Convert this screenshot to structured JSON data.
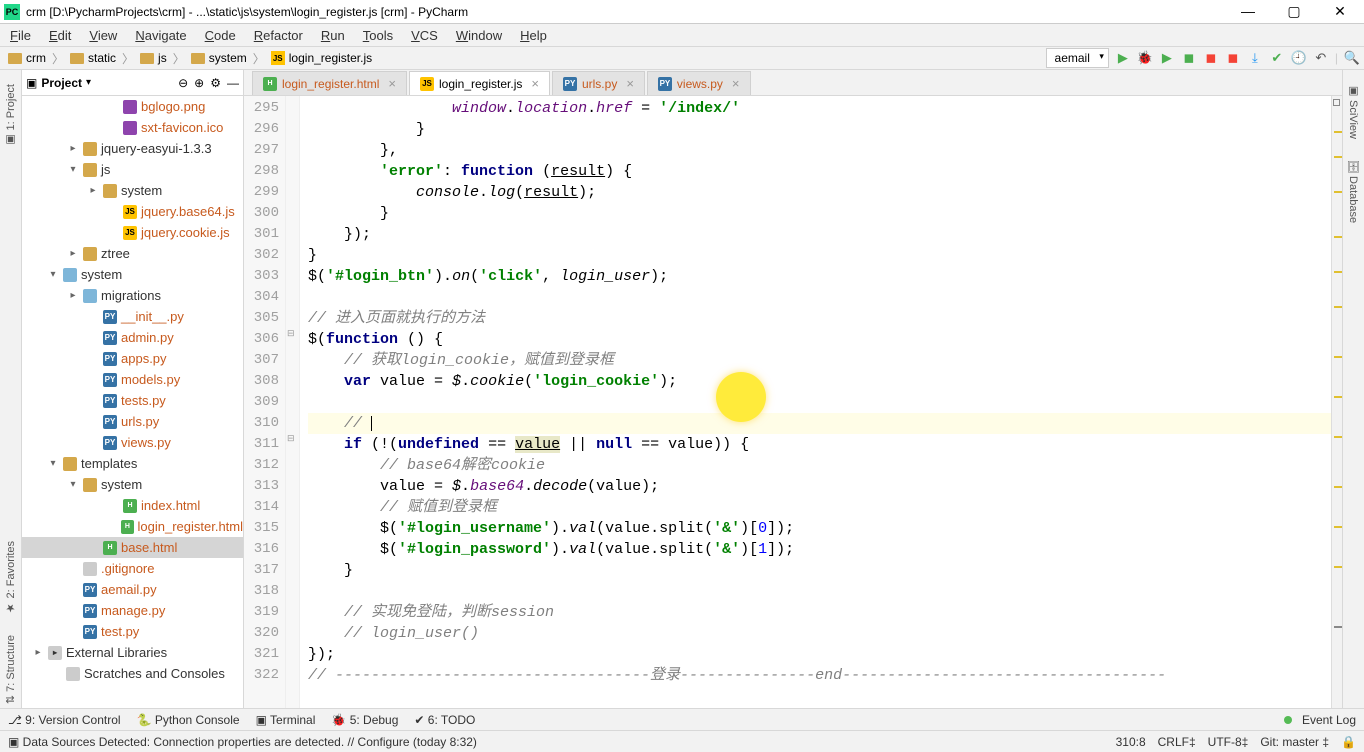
{
  "title": "crm [D:\\PycharmProjects\\crm] - ...\\static\\js\\system\\login_register.js [crm] - PyCharm",
  "menus": [
    "File",
    "Edit",
    "View",
    "Navigate",
    "Code",
    "Refactor",
    "Run",
    "Tools",
    "VCS",
    "Window",
    "Help"
  ],
  "breadcrumb": [
    "crm",
    "static",
    "js",
    "system",
    "login_register.js"
  ],
  "run_config": "aemail",
  "toolbar_icons": [
    "run",
    "debug",
    "coverage",
    "profile",
    "stop-disabled",
    "stop",
    "update",
    "more",
    "search"
  ],
  "project_toolbar": {
    "label": "Project"
  },
  "tree": [
    {
      "indent": 85,
      "ico": "img",
      "label": "bglogo.png",
      "orange": true
    },
    {
      "indent": 85,
      "ico": "img",
      "label": "sxt-favicon.ico",
      "orange": true
    },
    {
      "indent": 45,
      "chev": "▸",
      "ico": "dir",
      "label": "jquery-easyui-1.3.3"
    },
    {
      "indent": 45,
      "chev": "▾",
      "ico": "dir",
      "label": "js"
    },
    {
      "indent": 65,
      "chev": "▸",
      "ico": "dir",
      "label": "system"
    },
    {
      "indent": 85,
      "ico": "js",
      "label": "jquery.base64.js",
      "orange": true
    },
    {
      "indent": 85,
      "ico": "js",
      "label": "jquery.cookie.js",
      "orange": true
    },
    {
      "indent": 45,
      "chev": "▸",
      "ico": "dir",
      "label": "ztree"
    },
    {
      "indent": 25,
      "chev": "▾",
      "ico": "pkg",
      "label": "system"
    },
    {
      "indent": 45,
      "chev": "▸",
      "ico": "pkg",
      "label": "migrations"
    },
    {
      "indent": 65,
      "ico": "py",
      "label": "__init__.py",
      "orange": true
    },
    {
      "indent": 65,
      "ico": "py",
      "label": "admin.py",
      "orange": true
    },
    {
      "indent": 65,
      "ico": "py",
      "label": "apps.py",
      "orange": true
    },
    {
      "indent": 65,
      "ico": "py",
      "label": "models.py",
      "orange": true
    },
    {
      "indent": 65,
      "ico": "py",
      "label": "tests.py",
      "orange": true
    },
    {
      "indent": 65,
      "ico": "py",
      "label": "urls.py",
      "orange": true
    },
    {
      "indent": 65,
      "ico": "py",
      "label": "views.py",
      "orange": true
    },
    {
      "indent": 25,
      "chev": "▾",
      "ico": "dir",
      "label": "templates"
    },
    {
      "indent": 45,
      "chev": "▾",
      "ico": "dir",
      "label": "system"
    },
    {
      "indent": 85,
      "ico": "html",
      "label": "index.html",
      "orange": true
    },
    {
      "indent": 85,
      "ico": "html",
      "label": "login_register.html",
      "orange": true
    },
    {
      "indent": 65,
      "ico": "html",
      "label": "base.html",
      "orange": true,
      "selected": true
    },
    {
      "indent": 45,
      "ico": "txt",
      "label": ".gitignore",
      "orange": true
    },
    {
      "indent": 45,
      "ico": "py",
      "label": "aemail.py",
      "orange": true
    },
    {
      "indent": 45,
      "ico": "py",
      "label": "manage.py",
      "orange": true
    },
    {
      "indent": 45,
      "ico": "py",
      "label": "test.py",
      "orange": true
    },
    {
      "indent": 10,
      "chev": "▸",
      "ico": "lib",
      "label": "External Libraries"
    },
    {
      "indent": 28,
      "ico": "txt",
      "label": "Scratches and Consoles"
    }
  ],
  "tabs": [
    {
      "ico": "html",
      "label": "login_register.html",
      "orange": true
    },
    {
      "ico": "js",
      "label": "login_register.js",
      "active": true
    },
    {
      "ico": "py",
      "label": "urls.py",
      "orange": true
    },
    {
      "ico": "py",
      "label": "views.py",
      "orange": true
    }
  ],
  "lines_start": 295,
  "lines_end": 322,
  "yellow_circle": true,
  "side_tools_left": [
    "1: Project"
  ],
  "side_tools_left2": [
    "2: Favorites",
    "7: Structure"
  ],
  "side_tools_right": [
    "SciView",
    "Database"
  ],
  "bottom_tools": [
    "9: Version Control",
    "Python Console",
    "Terminal",
    "5: Debug",
    "6: TODO"
  ],
  "event_log": "Event Log",
  "status_left": "Data Sources Detected: Connection properties are detected. // Configure (today 8:32)",
  "status_right": {
    "pos": "310:8",
    "eol": "CRLF",
    "enc": "UTF-8",
    "git": "Git: master"
  }
}
